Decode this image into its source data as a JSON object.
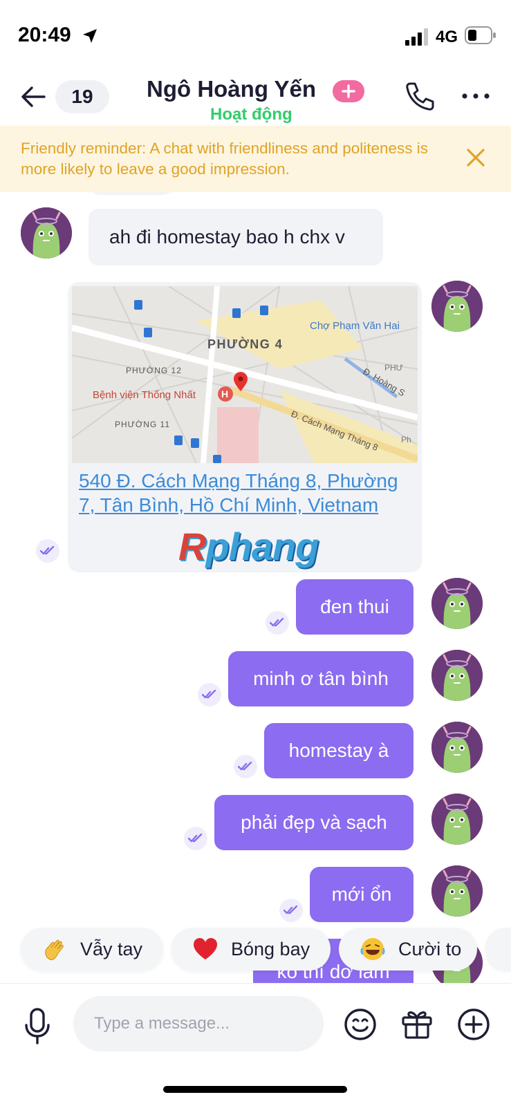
{
  "status_bar": {
    "time": "20:49",
    "network": "4G"
  },
  "header": {
    "unread_count": "19",
    "contact_name": "Ngô Hoàng Yến",
    "contact_status": "Hoạt động"
  },
  "reminder": {
    "text": "Friendly reminder: A chat with friendliness and politeness is more likely to leave a good impression."
  },
  "messages": {
    "incoming_text": "ah đi homestay bao h chx v",
    "map": {
      "labels": {
        "ward4": "PHƯỜNG 4",
        "ward12": "PHƯỜNG 12",
        "ward11": "PHƯỜNG 11",
        "market": "Chợ Phạm Văn Hai",
        "hospital": "Bệnh viện Thống Nhất",
        "road1": "Đ. Cách Mạng Tháng 8",
        "road2": "Đ. Hoàng S",
        "ward_edge": "PHƯ",
        "ph": "Ph"
      },
      "address": "540 Đ. Cách Mạng Tháng 8, Phường 7, Tân Bình, Hồ Chí Minh, Vietnam"
    },
    "watermark": {
      "part1": "R",
      "part2": "phang"
    },
    "outgoing": [
      "đen thui",
      "minh ơ tân bình",
      "homestay à",
      "phải đẹp và sạch",
      "mới ổn",
      "ko thì dơ lắm"
    ]
  },
  "quick_reactions": [
    {
      "label": "Vẫy tay",
      "icon": "waving-hand-emoji"
    },
    {
      "label": "Bóng bay",
      "icon": "heart-emoji"
    },
    {
      "label": "Cười to",
      "icon": "laughing-emoji"
    }
  ],
  "composer": {
    "placeholder": "Type a message..."
  },
  "colors": {
    "accent": "#8c6cf0",
    "online": "#33cc6b",
    "reminder_bg": "#fdf5e0",
    "reminder_text": "#e0a326",
    "link": "#3b8bd9",
    "plus_badge": "#f36aa1"
  }
}
